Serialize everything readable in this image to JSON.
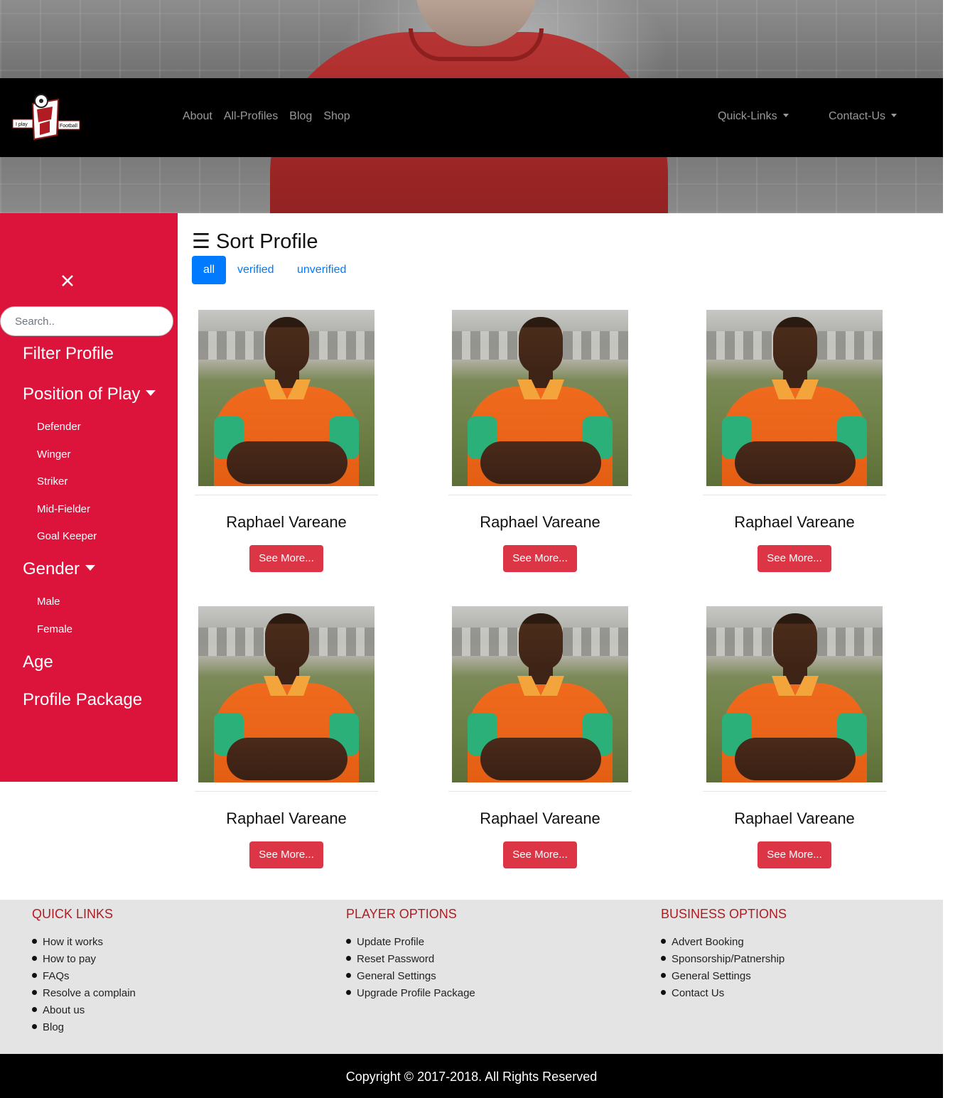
{
  "brand": {
    "logo_text_left": "I play",
    "logo_text_right": "Football"
  },
  "nav": {
    "links": [
      "About",
      "All-Profiles",
      "Blog",
      "Shop"
    ],
    "quick_links": "Quick-Links",
    "contact_us": "Contact-Us"
  },
  "sidebar": {
    "search_placeholder": "Search..",
    "filter_title": "Filter Profile",
    "position_title": "Position of Play",
    "positions": [
      "Defender",
      "Winger",
      "Striker",
      "Mid-Fielder",
      "Goal Keeper"
    ],
    "gender_title": "Gender",
    "genders": [
      "Male",
      "Female"
    ],
    "age_title": "Age",
    "package_title": "Profile Package"
  },
  "main": {
    "title": "☰ Sort Profile",
    "tabs": [
      "all",
      "verified",
      "unverified"
    ],
    "active_tab": "all",
    "profiles": [
      {
        "name": "Raphael Vareane",
        "button": "See More..."
      },
      {
        "name": "Raphael Vareane",
        "button": "See More..."
      },
      {
        "name": "Raphael Vareane",
        "button": "See More..."
      },
      {
        "name": "Raphael Vareane",
        "button": "See More..."
      },
      {
        "name": "Raphael Vareane",
        "button": "See More..."
      },
      {
        "name": "Raphael Vareane",
        "button": "See More..."
      }
    ]
  },
  "footer": {
    "quick_links": {
      "title": "QUICK LINKS",
      "items": [
        "How it works",
        "How to pay",
        "FAQs",
        "Resolve a complain",
        "About us",
        "Blog"
      ]
    },
    "player_options": {
      "title": "PLAYER OPTIONS",
      "items": [
        "Update Profile",
        "Reset Password",
        "General Settings",
        "Upgrade Profile Package"
      ]
    },
    "business_options": {
      "title": "BUSINESS OPTIONS",
      "items": [
        "Advert Booking",
        "Sponsorship/Patnership",
        "General Settings",
        "Contact Us"
      ]
    },
    "copyright": "Copyright © 2017-2018. All Rights Reserved"
  },
  "colors": {
    "sidebar": "#dc143c",
    "button": "#dc3545",
    "active_tab": "#007bff",
    "footer_heading": "#b01c22"
  }
}
